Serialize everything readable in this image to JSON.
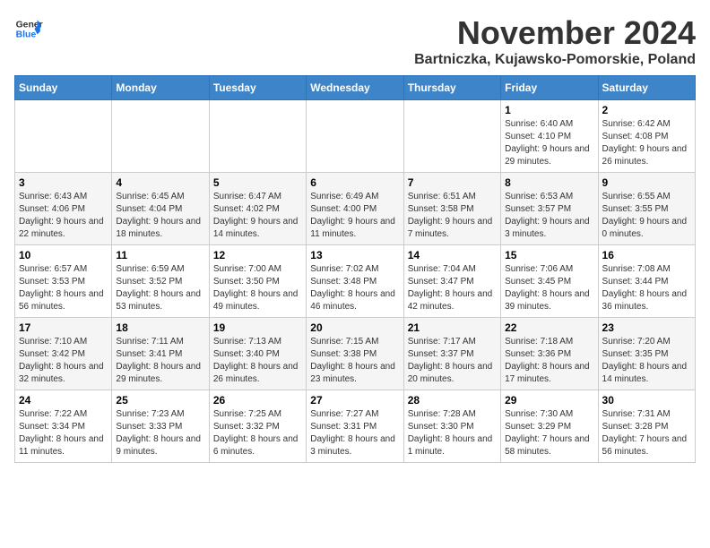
{
  "logo": {
    "line1": "General",
    "line2": "Blue"
  },
  "title": "November 2024",
  "subtitle": "Bartniczka, Kujawsko-Pomorskie, Poland",
  "days_of_week": [
    "Sunday",
    "Monday",
    "Tuesday",
    "Wednesday",
    "Thursday",
    "Friday",
    "Saturday"
  ],
  "weeks": [
    [
      {
        "day": "",
        "info": ""
      },
      {
        "day": "",
        "info": ""
      },
      {
        "day": "",
        "info": ""
      },
      {
        "day": "",
        "info": ""
      },
      {
        "day": "",
        "info": ""
      },
      {
        "day": "1",
        "info": "Sunrise: 6:40 AM\nSunset: 4:10 PM\nDaylight: 9 hours and 29 minutes."
      },
      {
        "day": "2",
        "info": "Sunrise: 6:42 AM\nSunset: 4:08 PM\nDaylight: 9 hours and 26 minutes."
      }
    ],
    [
      {
        "day": "3",
        "info": "Sunrise: 6:43 AM\nSunset: 4:06 PM\nDaylight: 9 hours and 22 minutes."
      },
      {
        "day": "4",
        "info": "Sunrise: 6:45 AM\nSunset: 4:04 PM\nDaylight: 9 hours and 18 minutes."
      },
      {
        "day": "5",
        "info": "Sunrise: 6:47 AM\nSunset: 4:02 PM\nDaylight: 9 hours and 14 minutes."
      },
      {
        "day": "6",
        "info": "Sunrise: 6:49 AM\nSunset: 4:00 PM\nDaylight: 9 hours and 11 minutes."
      },
      {
        "day": "7",
        "info": "Sunrise: 6:51 AM\nSunset: 3:58 PM\nDaylight: 9 hours and 7 minutes."
      },
      {
        "day": "8",
        "info": "Sunrise: 6:53 AM\nSunset: 3:57 PM\nDaylight: 9 hours and 3 minutes."
      },
      {
        "day": "9",
        "info": "Sunrise: 6:55 AM\nSunset: 3:55 PM\nDaylight: 9 hours and 0 minutes."
      }
    ],
    [
      {
        "day": "10",
        "info": "Sunrise: 6:57 AM\nSunset: 3:53 PM\nDaylight: 8 hours and 56 minutes."
      },
      {
        "day": "11",
        "info": "Sunrise: 6:59 AM\nSunset: 3:52 PM\nDaylight: 8 hours and 53 minutes."
      },
      {
        "day": "12",
        "info": "Sunrise: 7:00 AM\nSunset: 3:50 PM\nDaylight: 8 hours and 49 minutes."
      },
      {
        "day": "13",
        "info": "Sunrise: 7:02 AM\nSunset: 3:48 PM\nDaylight: 8 hours and 46 minutes."
      },
      {
        "day": "14",
        "info": "Sunrise: 7:04 AM\nSunset: 3:47 PM\nDaylight: 8 hours and 42 minutes."
      },
      {
        "day": "15",
        "info": "Sunrise: 7:06 AM\nSunset: 3:45 PM\nDaylight: 8 hours and 39 minutes."
      },
      {
        "day": "16",
        "info": "Sunrise: 7:08 AM\nSunset: 3:44 PM\nDaylight: 8 hours and 36 minutes."
      }
    ],
    [
      {
        "day": "17",
        "info": "Sunrise: 7:10 AM\nSunset: 3:42 PM\nDaylight: 8 hours and 32 minutes."
      },
      {
        "day": "18",
        "info": "Sunrise: 7:11 AM\nSunset: 3:41 PM\nDaylight: 8 hours and 29 minutes."
      },
      {
        "day": "19",
        "info": "Sunrise: 7:13 AM\nSunset: 3:40 PM\nDaylight: 8 hours and 26 minutes."
      },
      {
        "day": "20",
        "info": "Sunrise: 7:15 AM\nSunset: 3:38 PM\nDaylight: 8 hours and 23 minutes."
      },
      {
        "day": "21",
        "info": "Sunrise: 7:17 AM\nSunset: 3:37 PM\nDaylight: 8 hours and 20 minutes."
      },
      {
        "day": "22",
        "info": "Sunrise: 7:18 AM\nSunset: 3:36 PM\nDaylight: 8 hours and 17 minutes."
      },
      {
        "day": "23",
        "info": "Sunrise: 7:20 AM\nSunset: 3:35 PM\nDaylight: 8 hours and 14 minutes."
      }
    ],
    [
      {
        "day": "24",
        "info": "Sunrise: 7:22 AM\nSunset: 3:34 PM\nDaylight: 8 hours and 11 minutes."
      },
      {
        "day": "25",
        "info": "Sunrise: 7:23 AM\nSunset: 3:33 PM\nDaylight: 8 hours and 9 minutes."
      },
      {
        "day": "26",
        "info": "Sunrise: 7:25 AM\nSunset: 3:32 PM\nDaylight: 8 hours and 6 minutes."
      },
      {
        "day": "27",
        "info": "Sunrise: 7:27 AM\nSunset: 3:31 PM\nDaylight: 8 hours and 3 minutes."
      },
      {
        "day": "28",
        "info": "Sunrise: 7:28 AM\nSunset: 3:30 PM\nDaylight: 8 hours and 1 minute."
      },
      {
        "day": "29",
        "info": "Sunrise: 7:30 AM\nSunset: 3:29 PM\nDaylight: 7 hours and 58 minutes."
      },
      {
        "day": "30",
        "info": "Sunrise: 7:31 AM\nSunset: 3:28 PM\nDaylight: 7 hours and 56 minutes."
      }
    ]
  ]
}
